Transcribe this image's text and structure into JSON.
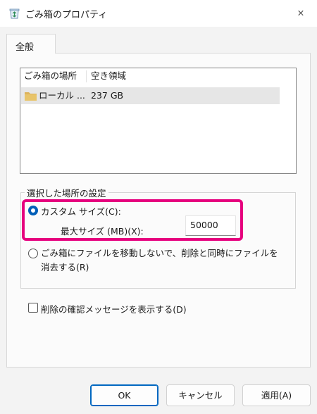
{
  "window": {
    "title": "ごみ箱のプロパティ",
    "close_glyph": "✕"
  },
  "tabs": [
    {
      "label": "全般"
    }
  ],
  "list": {
    "columns": [
      "ごみ箱の場所",
      "空き領域"
    ],
    "rows": [
      {
        "location": "ローカル ...",
        "free_space": "237 GB"
      }
    ]
  },
  "group": {
    "label": "選択した場所の設定",
    "custom_size_label": "カスタム サイズ(C):",
    "custom_size_selected": true,
    "max_size_label": "最大サイズ (MB)(X):",
    "max_size_value": "50000",
    "no_move_label": "ごみ箱にファイルを移動しないで、削除と同時にファイルを消去する(R)"
  },
  "confirm_delete": {
    "label": "削除の確認メッセージを表示する(D)",
    "checked": false
  },
  "buttons": {
    "ok": "OK",
    "cancel": "キャンセル",
    "apply": "適用(A)"
  },
  "colors": {
    "accent": "#005fb8",
    "highlight": "#e6007e",
    "folder": "#dcb35c"
  },
  "icons": {
    "title": "recycle-bin-icon",
    "folder": "folder-icon",
    "close": "close-icon"
  }
}
